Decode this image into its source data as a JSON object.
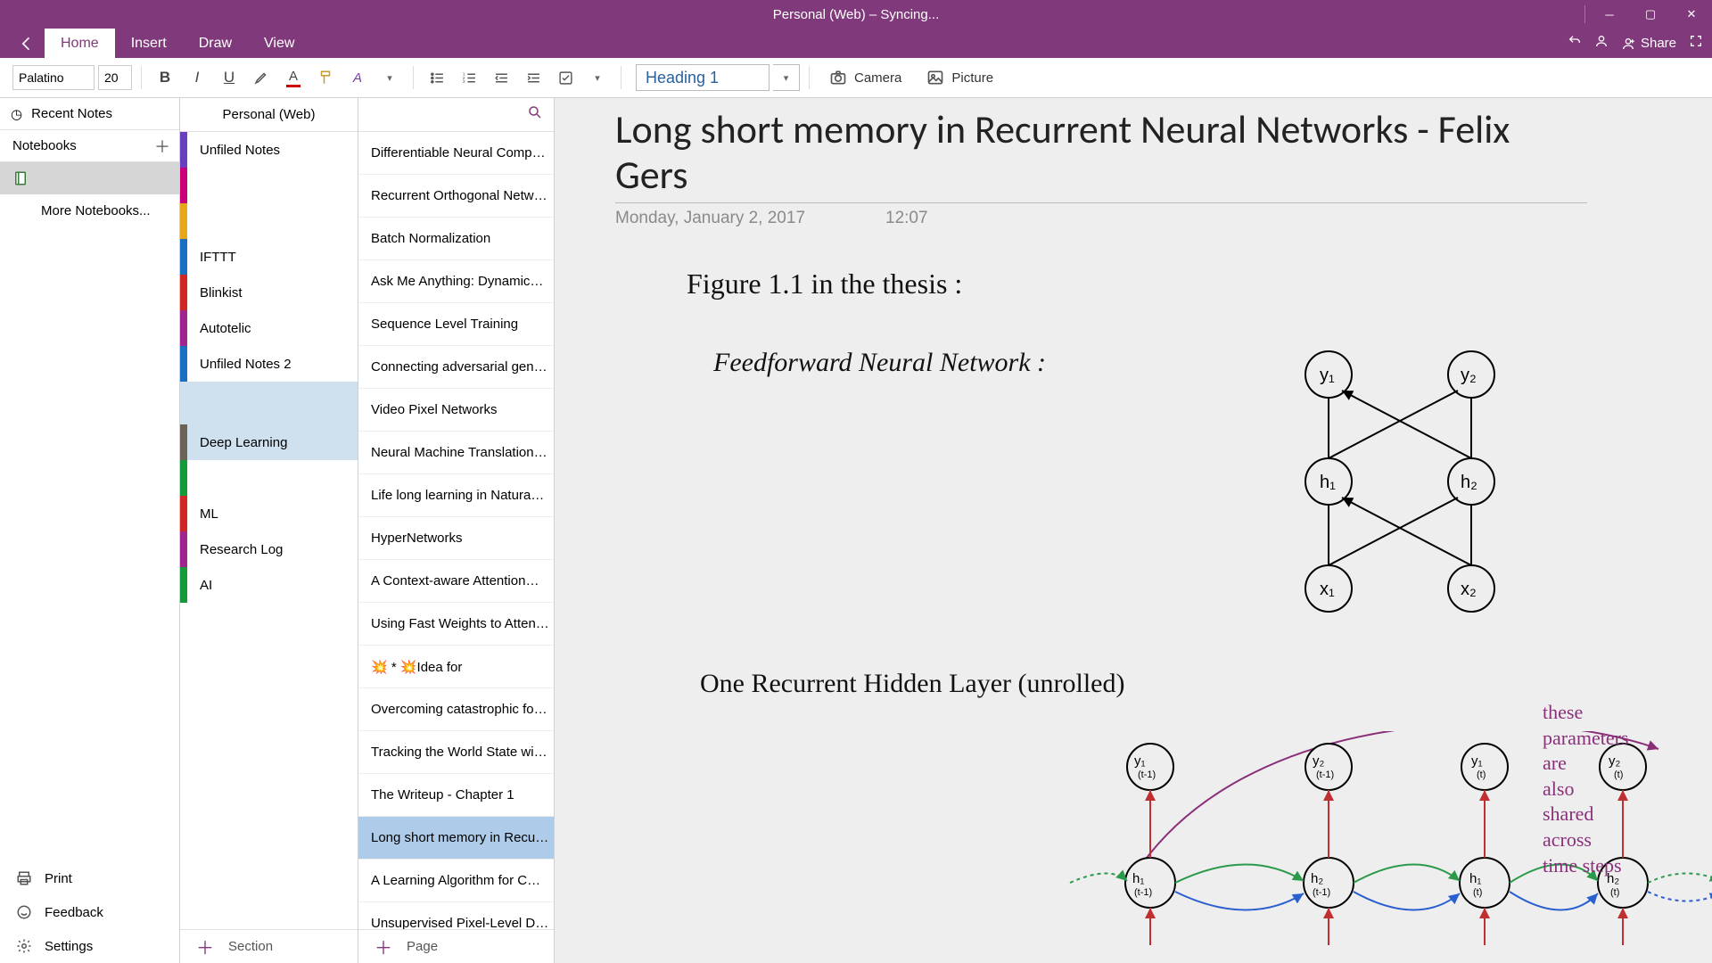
{
  "window": {
    "title": "Personal (Web) – Syncing..."
  },
  "ribbon": {
    "tabs": [
      "Home",
      "Insert",
      "Draw",
      "View"
    ],
    "active": 0,
    "share_label": "Share"
  },
  "toolbar": {
    "font_name": "Palatino",
    "font_size": "20",
    "style_selected": "Heading 1",
    "camera_label": "Camera",
    "picture_label": "Picture"
  },
  "nav": {
    "recent_label": "Recent Notes",
    "notebooks_label": "Notebooks",
    "more_label": "More Notebooks...",
    "footer": {
      "print": "Print",
      "feedback": "Feedback",
      "settings": "Settings"
    }
  },
  "sections": {
    "header": "Personal (Web)",
    "items": [
      {
        "label": "Unfiled Notes",
        "color": "#6a3fbf"
      },
      {
        "label": "",
        "color": "#c9007a"
      },
      {
        "label": "",
        "color": "#e6a817"
      },
      {
        "label": "IFTTT",
        "color": "#1b6fc2"
      },
      {
        "label": "Blinkist",
        "color": "#d02626"
      },
      {
        "label": "Autotelic",
        "color": "#a0258f"
      },
      {
        "label": "Unfiled Notes 2",
        "color": "#1b6fc2"
      }
    ],
    "items2": [
      {
        "label": "Deep Learning",
        "color": "#6b6355",
        "selected": true
      },
      {
        "label": "",
        "color": "#149b37"
      },
      {
        "label": "ML",
        "color": "#d02626"
      },
      {
        "label": "Research Log",
        "color": "#a0258f"
      },
      {
        "label": "AI",
        "color": "#149b37"
      }
    ],
    "add_label": "Section"
  },
  "pages": {
    "items": [
      "Differentiable Neural Comp…",
      "Recurrent Orthogonal Netw…",
      "Batch Normalization",
      "Ask Me Anything: Dynamic…",
      "Sequence Level Training",
      "Connecting adversarial gen…",
      "Video Pixel Networks",
      "Neural Machine Translation…",
      "Life long learning in Natura…",
      "HyperNetworks",
      "A Context-aware Attention…",
      "Using Fast Weights to Atten…",
      "💥 * 💥Idea for",
      "Overcoming catastrophic fo…",
      "Tracking the World State wi…",
      "The Writeup - Chapter 1",
      "Long short memory in Recu…",
      "A Learning Algorithm for C…",
      "Unsupervised Pixel-Level D…"
    ],
    "selected_index": 16,
    "add_label": "Page"
  },
  "note": {
    "title": "Long short memory in Recurrent Neural Networks - Felix Gers",
    "date": "Monday, January 2, 2017",
    "time": "12:07",
    "hand1": "Figure 1.1  in the thesis :",
    "hand2": "Feedforward Neural Network :",
    "hand3": "One  Recurrent  Hidden  Layer  (unrolled)",
    "annotation": "these parameters are\nalso shared across\ntime steps"
  }
}
